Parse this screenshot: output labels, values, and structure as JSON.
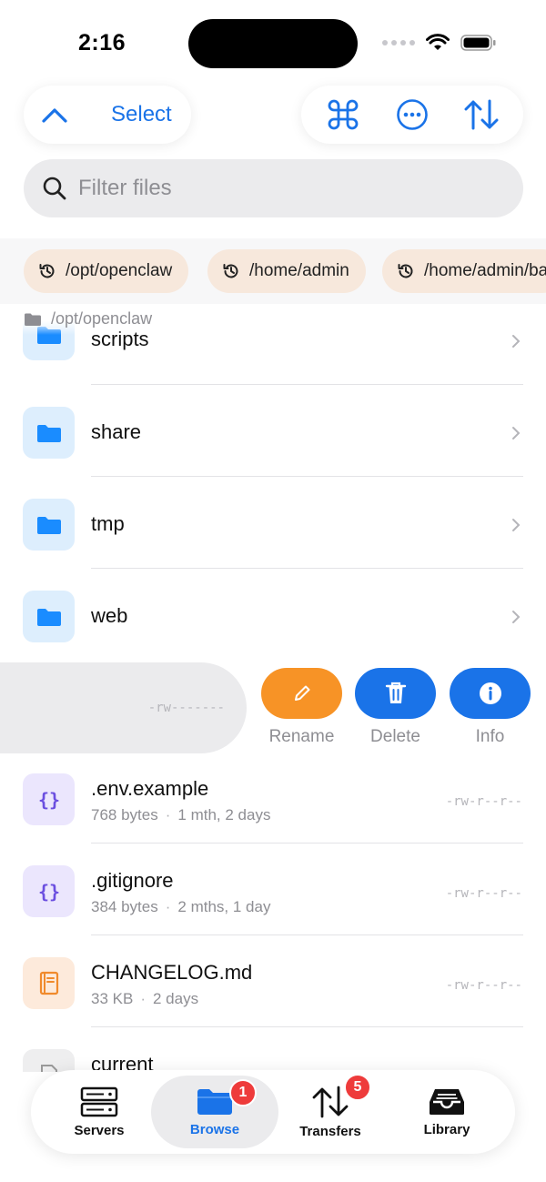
{
  "status": {
    "time": "2:16"
  },
  "toolbar": {
    "select_label": "Select"
  },
  "search": {
    "placeholder": "Filter files"
  },
  "recent_paths": [
    "/opt/openclaw",
    "/home/admin",
    "/home/admin/ba"
  ],
  "breadcrumb": "/opt/openclaw",
  "folders": [
    {
      "name": "scripts"
    },
    {
      "name": "share"
    },
    {
      "name": "tmp"
    },
    {
      "name": "web"
    }
  ],
  "swiped_row": {
    "permissions": "-rw-------"
  },
  "actions": {
    "rename": "Rename",
    "delete": "Delete",
    "info": "Info"
  },
  "files": [
    {
      "name": ".env.example",
      "size": "768 bytes",
      "age": "1 mth, 2 days",
      "permissions": "-rw-r--r--",
      "icon": "code-braces-icon"
    },
    {
      "name": ".gitignore",
      "size": "384 bytes",
      "age": "2 mths, 1 day",
      "permissions": "-rw-r--r--",
      "icon": "code-braces-icon"
    },
    {
      "name": "CHANGELOG.md",
      "size": "33 KB",
      "age": "2 days",
      "permissions": "-rw-r--r--",
      "icon": "book-icon"
    },
    {
      "name": "current",
      "icon": "file-icon"
    }
  ],
  "tabs": [
    {
      "label": "Servers"
    },
    {
      "label": "Browse",
      "badge": "1"
    },
    {
      "label": "Transfers",
      "badge": "5"
    },
    {
      "label": "Library"
    }
  ],
  "colors": {
    "accent": "#1a73e8",
    "rename": "#f79326",
    "delete": "#1a73e8",
    "info": "#1a73e8",
    "badge": "#ee3b3b"
  }
}
